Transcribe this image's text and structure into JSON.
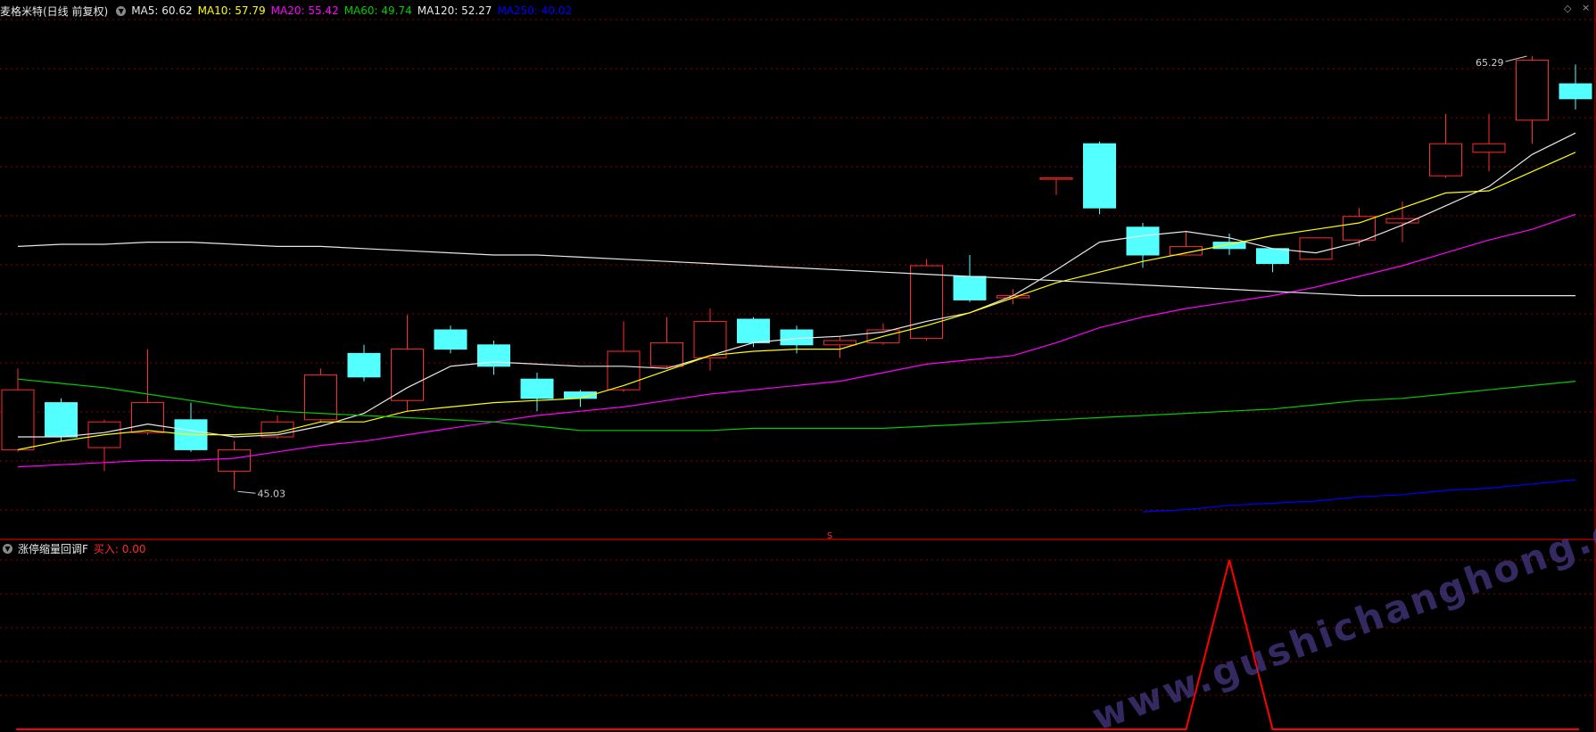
{
  "main_header": {
    "title": "麦格米特(日线 前复权)",
    "ma": [
      {
        "label": "MA5: 60.62",
        "color": "#e8e8e8"
      },
      {
        "label": "MA10: 57.79",
        "color": "#ffff00"
      },
      {
        "label": "MA20: 55.42",
        "color": "#ff00ff"
      },
      {
        "label": "MA60: 49.74",
        "color": "#00cc00"
      },
      {
        "label": "MA120: 52.27",
        "color": "#e8e8e8"
      },
      {
        "label": "MA250: 40.02",
        "color": "#0000ff"
      }
    ]
  },
  "sub_header": {
    "title": "涨停缩量回调F",
    "signal_label": "买入: 0.00"
  },
  "colors": {
    "up": "#ff2a2a",
    "down": "#54ffff",
    "grid": "#8b0000",
    "border": "#b00000",
    "text": "#cccccc",
    "signal": "#ff0000"
  },
  "watermark": "www.gushichanghong.com",
  "chart_data": [
    {
      "type": "candlestick",
      "title": "麦格米特(日线 前复权)",
      "ylim": [
        43,
        67
      ],
      "annotations": [
        {
          "label": "65.29",
          "index": 35,
          "price": 65.29,
          "kind": "high"
        },
        {
          "label": "45.03",
          "index": 5,
          "price": 45.03,
          "kind": "low"
        }
      ],
      "candles": [
        {
          "o": 46.9,
          "c": 49.7,
          "h": 50.7,
          "l": 46.8
        },
        {
          "o": 49.1,
          "c": 47.5,
          "h": 49.3,
          "l": 47.3
        },
        {
          "o": 47.0,
          "c": 48.2,
          "h": 48.3,
          "l": 45.9
        },
        {
          "o": 47.7,
          "c": 49.1,
          "h": 51.6,
          "l": 47.6
        },
        {
          "o": 48.3,
          "c": 46.9,
          "h": 49.1,
          "l": 46.8
        },
        {
          "o": 45.9,
          "c": 46.9,
          "h": 47.3,
          "l": 45.03
        },
        {
          "o": 47.5,
          "c": 48.2,
          "h": 48.5,
          "l": 47.4
        },
        {
          "o": 48.3,
          "c": 50.4,
          "h": 50.7,
          "l": 48.2
        },
        {
          "o": 51.4,
          "c": 50.3,
          "h": 51.8,
          "l": 50.1
        },
        {
          "o": 49.2,
          "c": 51.6,
          "h": 53.2,
          "l": 48.7
        },
        {
          "o": 52.5,
          "c": 51.6,
          "h": 52.7,
          "l": 51.4
        },
        {
          "o": 51.8,
          "c": 50.8,
          "h": 52.0,
          "l": 50.4
        },
        {
          "o": 50.2,
          "c": 49.3,
          "h": 50.5,
          "l": 48.7
        },
        {
          "o": 49.6,
          "c": 49.3,
          "h": 49.7,
          "l": 48.9
        },
        {
          "o": 49.7,
          "c": 51.5,
          "h": 52.9,
          "l": 49.6
        },
        {
          "o": 50.8,
          "c": 51.9,
          "h": 53.1,
          "l": 50.7
        },
        {
          "o": 51.2,
          "c": 52.9,
          "h": 53.5,
          "l": 50.6
        },
        {
          "o": 53.0,
          "c": 51.9,
          "h": 53.1,
          "l": 51.7
        },
        {
          "o": 52.5,
          "c": 51.8,
          "h": 52.7,
          "l": 51.4
        },
        {
          "o": 51.8,
          "c": 52.0,
          "h": 52.2,
          "l": 51.2
        },
        {
          "o": 51.9,
          "c": 52.5,
          "h": 52.8,
          "l": 51.8
        },
        {
          "o": 52.1,
          "c": 55.5,
          "h": 55.8,
          "l": 52.0
        },
        {
          "o": 55.0,
          "c": 53.9,
          "h": 56.0,
          "l": 53.8
        },
        {
          "o": 54.0,
          "c": 54.1,
          "h": 54.4,
          "l": 53.7
        },
        {
          "o": 59.6,
          "c": 59.6,
          "h": 59.6,
          "l": 58.8
        },
        {
          "o": 61.2,
          "c": 58.2,
          "h": 61.3,
          "l": 57.9
        },
        {
          "o": 57.3,
          "c": 56.0,
          "h": 57.5,
          "l": 55.4
        },
        {
          "o": 56.0,
          "c": 56.4,
          "h": 57.1,
          "l": 56.0
        },
        {
          "o": 56.6,
          "c": 56.3,
          "h": 57.0,
          "l": 56.0
        },
        {
          "o": 56.3,
          "c": 55.6,
          "h": 56.3,
          "l": 55.2
        },
        {
          "o": 55.8,
          "c": 56.8,
          "h": 56.8,
          "l": 55.8
        },
        {
          "o": 56.7,
          "c": 57.8,
          "h": 58.2,
          "l": 56.4
        },
        {
          "o": 57.5,
          "c": 57.7,
          "h": 58.5,
          "l": 56.6
        },
        {
          "o": 59.7,
          "c": 61.2,
          "h": 62.6,
          "l": 59.6
        },
        {
          "o": 60.8,
          "c": 61.2,
          "h": 62.6,
          "l": 59.9
        },
        {
          "o": 62.3,
          "c": 65.1,
          "h": 65.29,
          "l": 61.2
        },
        {
          "o": 64.0,
          "c": 63.3,
          "h": 64.9,
          "l": 62.8
        }
      ],
      "series": [
        {
          "name": "MA5",
          "color": "#e8e8e8",
          "points": [
            [
              0,
              47.5
            ],
            [
              1,
              47.5
            ],
            [
              2,
              47.7
            ],
            [
              3,
              48.1
            ],
            [
              4,
              47.8
            ],
            [
              5,
              47.5
            ],
            [
              6,
              47.6
            ],
            [
              7,
              48.0
            ],
            [
              8,
              48.6
            ],
            [
              9,
              49.8
            ],
            [
              10,
              50.8
            ],
            [
              11,
              51.0
            ],
            [
              12,
              50.9
            ],
            [
              13,
              50.8
            ],
            [
              14,
              50.8
            ],
            [
              15,
              50.7
            ],
            [
              16,
              51.3
            ],
            [
              17,
              51.9
            ],
            [
              18,
              52.1
            ],
            [
              19,
              52.2
            ],
            [
              20,
              52.4
            ],
            [
              21,
              52.9
            ],
            [
              22,
              53.3
            ],
            [
              23,
              54.1
            ],
            [
              24,
              55.3
            ],
            [
              25,
              56.6
            ],
            [
              26,
              56.9
            ],
            [
              27,
              57.1
            ],
            [
              28,
              56.8
            ],
            [
              29,
              56.3
            ],
            [
              30,
              56.1
            ],
            [
              31,
              56.6
            ],
            [
              32,
              57.4
            ],
            [
              33,
              58.3
            ],
            [
              34,
              59.2
            ],
            [
              35,
              60.7
            ],
            [
              36,
              61.7
            ]
          ]
        },
        {
          "name": "MA10",
          "color": "#ffff00",
          "points": [
            [
              0,
              46.9
            ],
            [
              1,
              47.3
            ],
            [
              2,
              47.6
            ],
            [
              3,
              47.8
            ],
            [
              4,
              47.6
            ],
            [
              5,
              47.6
            ],
            [
              6,
              47.7
            ],
            [
              7,
              48.2
            ],
            [
              8,
              48.2
            ],
            [
              9,
              48.7
            ],
            [
              10,
              48.9
            ],
            [
              11,
              49.1
            ],
            [
              12,
              49.2
            ],
            [
              13,
              49.3
            ],
            [
              14,
              49.9
            ],
            [
              15,
              50.6
            ],
            [
              16,
              51.3
            ],
            [
              17,
              51.5
            ],
            [
              18,
              51.6
            ],
            [
              19,
              51.6
            ],
            [
              20,
              52.2
            ],
            [
              21,
              52.7
            ],
            [
              22,
              53.3
            ],
            [
              23,
              54.0
            ],
            [
              24,
              54.7
            ],
            [
              25,
              55.2
            ],
            [
              26,
              55.7
            ],
            [
              27,
              56.1
            ],
            [
              28,
              56.5
            ],
            [
              29,
              56.9
            ],
            [
              30,
              57.2
            ],
            [
              31,
              57.5
            ],
            [
              32,
              58.2
            ],
            [
              33,
              58.9
            ],
            [
              34,
              59.0
            ],
            [
              35,
              59.9
            ],
            [
              36,
              60.8
            ]
          ]
        },
        {
          "name": "MA20",
          "color": "#ff00ff",
          "points": [
            [
              0,
              46.1
            ],
            [
              1,
              46.2
            ],
            [
              2,
              46.3
            ],
            [
              3,
              46.4
            ],
            [
              4,
              46.4
            ],
            [
              5,
              46.5
            ],
            [
              6,
              46.8
            ],
            [
              7,
              47.1
            ],
            [
              8,
              47.3
            ],
            [
              9,
              47.6
            ],
            [
              10,
              47.9
            ],
            [
              11,
              48.2
            ],
            [
              12,
              48.5
            ],
            [
              13,
              48.7
            ],
            [
              14,
              48.9
            ],
            [
              15,
              49.2
            ],
            [
              16,
              49.5
            ],
            [
              17,
              49.7
            ],
            [
              18,
              49.9
            ],
            [
              19,
              50.1
            ],
            [
              20,
              50.5
            ],
            [
              21,
              50.9
            ],
            [
              22,
              51.1
            ],
            [
              23,
              51.3
            ],
            [
              24,
              51.9
            ],
            [
              25,
              52.6
            ],
            [
              26,
              53.1
            ],
            [
              27,
              53.5
            ],
            [
              28,
              53.8
            ],
            [
              29,
              54.1
            ],
            [
              30,
              54.5
            ],
            [
              31,
              55.0
            ],
            [
              32,
              55.5
            ],
            [
              33,
              56.1
            ],
            [
              34,
              56.7
            ],
            [
              35,
              57.2
            ],
            [
              36,
              57.9
            ]
          ]
        },
        {
          "name": "MA60",
          "color": "#00cc00",
          "points": [
            [
              0,
              50.2
            ],
            [
              1,
              50.0
            ],
            [
              2,
              49.8
            ],
            [
              3,
              49.5
            ],
            [
              4,
              49.2
            ],
            [
              5,
              48.9
            ],
            [
              6,
              48.7
            ],
            [
              7,
              48.6
            ],
            [
              8,
              48.5
            ],
            [
              9,
              48.4
            ],
            [
              10,
              48.3
            ],
            [
              11,
              48.2
            ],
            [
              12,
              48.0
            ],
            [
              13,
              47.8
            ],
            [
              14,
              47.8
            ],
            [
              15,
              47.8
            ],
            [
              16,
              47.8
            ],
            [
              17,
              47.9
            ],
            [
              18,
              47.9
            ],
            [
              19,
              47.9
            ],
            [
              20,
              47.9
            ],
            [
              21,
              48.0
            ],
            [
              22,
              48.1
            ],
            [
              23,
              48.2
            ],
            [
              24,
              48.3
            ],
            [
              25,
              48.4
            ],
            [
              26,
              48.5
            ],
            [
              27,
              48.6
            ],
            [
              28,
              48.7
            ],
            [
              29,
              48.8
            ],
            [
              30,
              49.0
            ],
            [
              31,
              49.2
            ],
            [
              32,
              49.3
            ],
            [
              33,
              49.5
            ],
            [
              34,
              49.7
            ],
            [
              35,
              49.9
            ],
            [
              36,
              50.1
            ]
          ]
        },
        {
          "name": "MA120",
          "color": "#e8e8e8",
          "points": [
            [
              0,
              56.4
            ],
            [
              1,
              56.5
            ],
            [
              2,
              56.5
            ],
            [
              3,
              56.6
            ],
            [
              4,
              56.6
            ],
            [
              5,
              56.5
            ],
            [
              6,
              56.4
            ],
            [
              7,
              56.4
            ],
            [
              8,
              56.3
            ],
            [
              9,
              56.2
            ],
            [
              10,
              56.1
            ],
            [
              11,
              56.0
            ],
            [
              12,
              56.0
            ],
            [
              13,
              55.9
            ],
            [
              14,
              55.8
            ],
            [
              15,
              55.7
            ],
            [
              16,
              55.6
            ],
            [
              17,
              55.5
            ],
            [
              18,
              55.4
            ],
            [
              19,
              55.3
            ],
            [
              20,
              55.2
            ],
            [
              21,
              55.1
            ],
            [
              22,
              55.0
            ],
            [
              23,
              54.9
            ],
            [
              24,
              54.8
            ],
            [
              25,
              54.7
            ],
            [
              26,
              54.6
            ],
            [
              27,
              54.5
            ],
            [
              28,
              54.4
            ],
            [
              29,
              54.3
            ],
            [
              30,
              54.2
            ],
            [
              31,
              54.1
            ],
            [
              32,
              54.1
            ],
            [
              33,
              54.1
            ],
            [
              34,
              54.1
            ],
            [
              35,
              54.1
            ],
            [
              36,
              54.1
            ]
          ]
        },
        {
          "name": "MA250",
          "color": "#0000ff",
          "points": [
            [
              26,
              44.0
            ],
            [
              27,
              44.1
            ],
            [
              28,
              44.3
            ],
            [
              29,
              44.4
            ],
            [
              30,
              44.5
            ],
            [
              31,
              44.7
            ],
            [
              32,
              44.8
            ],
            [
              33,
              45.0
            ],
            [
              34,
              45.1
            ],
            [
              35,
              45.3
            ],
            [
              36,
              45.5
            ]
          ]
        }
      ]
    },
    {
      "type": "line",
      "title": "涨停缩量回调F",
      "ylim": [
        0,
        1
      ],
      "series": [
        {
          "name": "买入",
          "color": "#ff0000",
          "points": [
            [
              0,
              0
            ],
            [
              27,
              0
            ],
            [
              28,
              1
            ],
            [
              29,
              0
            ],
            [
              36,
              0
            ]
          ]
        }
      ]
    }
  ]
}
